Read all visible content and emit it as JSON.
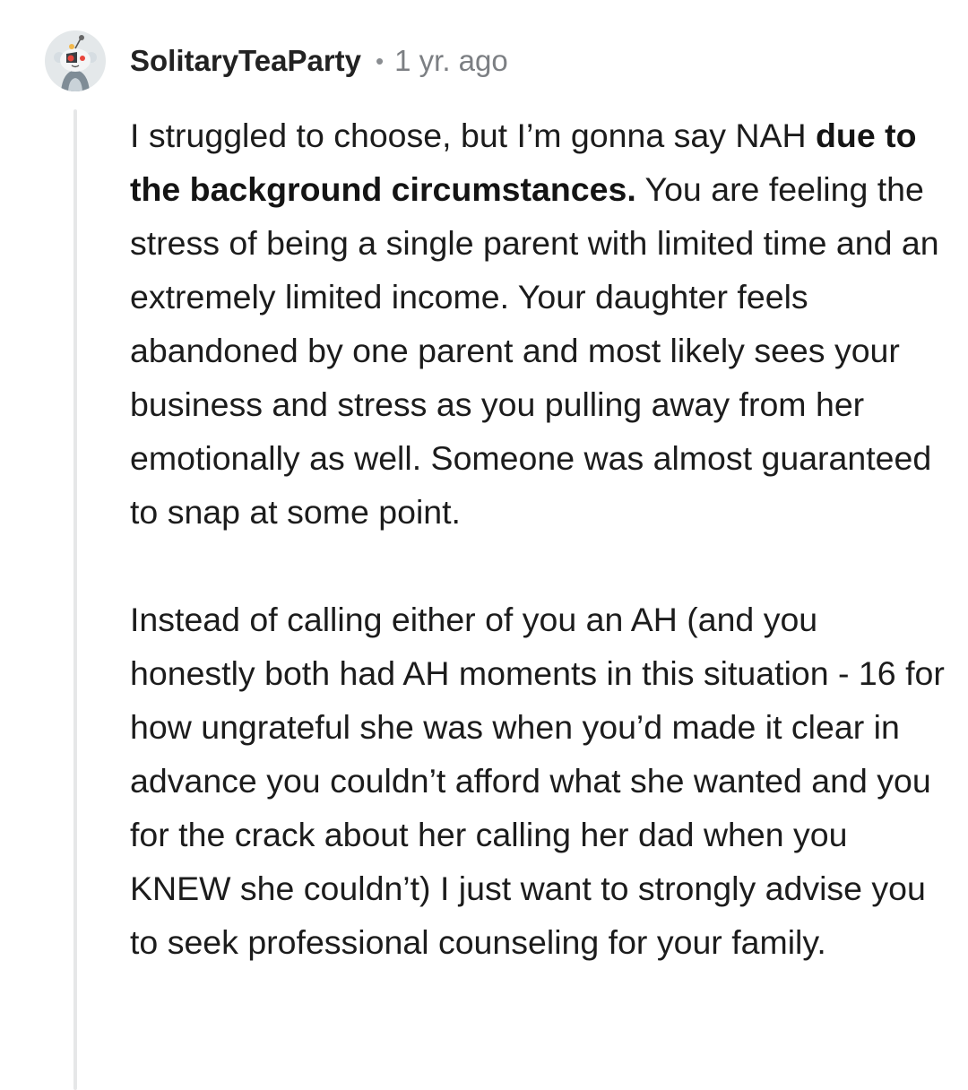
{
  "comment": {
    "avatar": "snoo-avatar-icon",
    "username": "SolitaryTeaParty",
    "separator": "•",
    "timestamp": "1 yr. ago",
    "paragraphs": [
      {
        "intro": "I struggled to choose, but I’m gonna say NAH ",
        "bold": "due to the background circumstances.",
        "rest": " You are feeling the stress of being a single parent with limited time and an extremely limited income. Your daughter feels abandoned by one parent and most likely sees your business and stress as you pulling away from her emotionally as well. Someone was almost guaranteed to snap at some point."
      },
      {
        "text": "Instead of calling either of you an AH (and you honestly both had AH moments in this situation - 16 for how ungrateful she was when you’d made it clear in advance you couldn’t afford what she wanted and you for the crack about her calling her dad when you KNEW she couldn’t) I just want to strongly advise you to seek professional counseling for your family."
      }
    ]
  },
  "colors": {
    "text": "#1c1c1c",
    "username": "#222222",
    "meta": "#7c7f83",
    "thread_line": "#e6e7e8",
    "avatar_bg": "#e4e8ea"
  }
}
